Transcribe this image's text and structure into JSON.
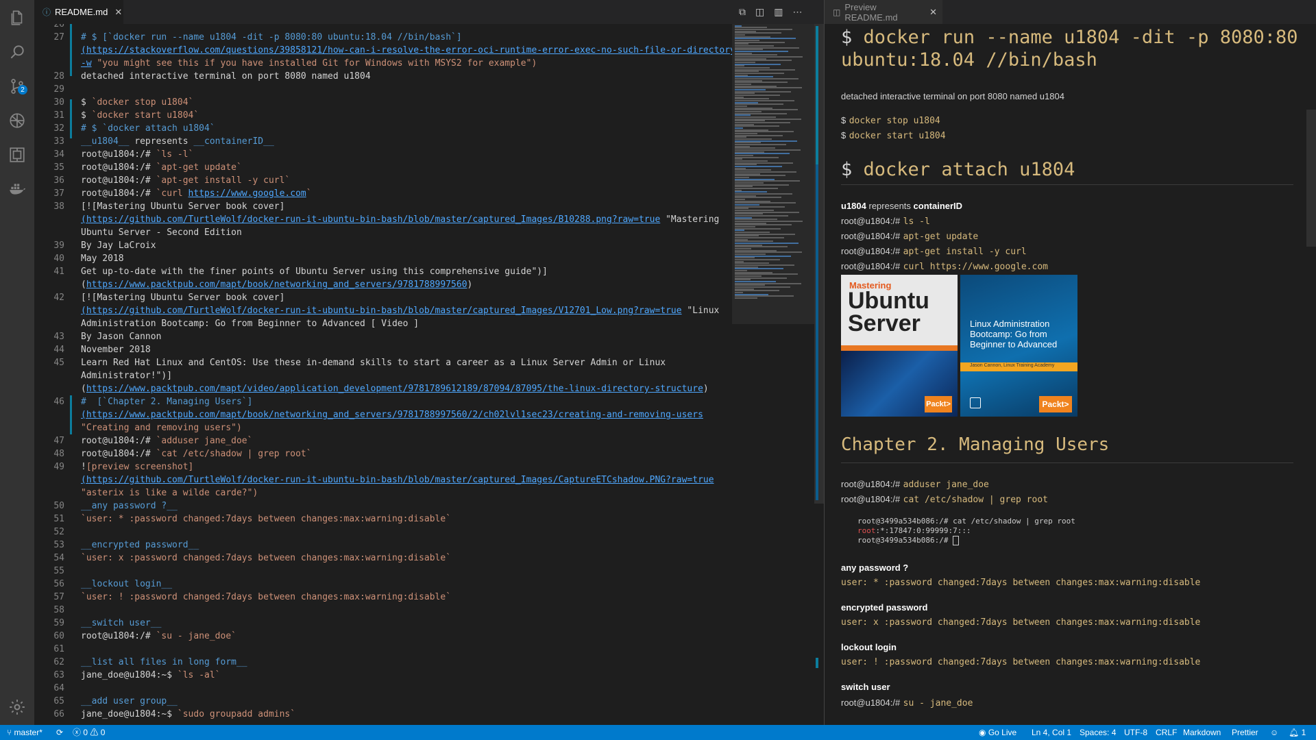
{
  "editor_tab": {
    "title": "README.md"
  },
  "preview_tab": {
    "title": "Preview README.md"
  },
  "editor_lines": [
    {
      "n": "26",
      "parts": [
        [
          "",
          ""
        ]
      ]
    },
    {
      "n": "27",
      "parts": [
        [
          "hash",
          "# $ [`docker run --name u1804 -dit -p 8080:80 ubuntu:18.04 //bin/bash`]"
        ]
      ]
    },
    {
      "n": "",
      "parts": [
        [
          "link",
          "(https://stackoverflow.com/questions/39858121/how-can-i-resolve-the-error-oci-runtime-error-exec-no-such-file-or-directory"
        ]
      ]
    },
    {
      "n": "",
      "parts": [
        [
          "link",
          "-w"
        ],
        [
          "str",
          " \"you might see this if you have installed Git for Windows with MSYS2 for example\")"
        ]
      ]
    },
    {
      "n": "28",
      "parts": [
        [
          "",
          "detached interactive terminal on port 8080 named u1804"
        ]
      ]
    },
    {
      "n": "29",
      "parts": [
        [
          "",
          ""
        ]
      ]
    },
    {
      "n": "30",
      "parts": [
        [
          "",
          "$ "
        ],
        [
          "code",
          "`docker stop u1804`"
        ]
      ]
    },
    {
      "n": "31",
      "parts": [
        [
          "",
          "$ "
        ],
        [
          "code",
          "`docker start u1804`"
        ]
      ]
    },
    {
      "n": "32",
      "parts": [
        [
          "hash",
          "# $ `docker attach u1804`"
        ]
      ]
    },
    {
      "n": "33",
      "parts": [
        [
          "bold",
          "__u1804__"
        ],
        [
          "",
          " represents "
        ],
        [
          "bold",
          "__containerID__"
        ]
      ]
    },
    {
      "n": "34",
      "parts": [
        [
          "",
          "root@u1804:/# "
        ],
        [
          "code",
          "`ls -l`"
        ]
      ]
    },
    {
      "n": "35",
      "parts": [
        [
          "",
          "root@u1804:/# "
        ],
        [
          "code",
          "`apt-get update`"
        ]
      ]
    },
    {
      "n": "36",
      "parts": [
        [
          "",
          "root@u1804:/# "
        ],
        [
          "code",
          "`apt-get install -y curl`"
        ]
      ]
    },
    {
      "n": "37",
      "parts": [
        [
          "",
          "root@u1804:/# "
        ],
        [
          "code",
          "`curl "
        ],
        [
          "link",
          "https://www.google.com"
        ],
        [
          "code",
          "`"
        ]
      ]
    },
    {
      "n": "38",
      "parts": [
        [
          "",
          "[![Mastering Ubuntu Server book cover]"
        ]
      ]
    },
    {
      "n": "",
      "parts": [
        [
          "link",
          "(https://github.com/TurtleWolf/docker-run-it-ubuntu-bin-bash/blob/master/captured_Images/B10288.png?raw=true"
        ],
        [
          "",
          " \"Mastering"
        ]
      ]
    },
    {
      "n": "",
      "parts": [
        [
          "",
          "Ubuntu Server - Second Edition"
        ]
      ]
    },
    {
      "n": "39",
      "parts": [
        [
          "",
          "By Jay LaCroix"
        ]
      ]
    },
    {
      "n": "40",
      "parts": [
        [
          "",
          "May 2018"
        ]
      ]
    },
    {
      "n": "41",
      "parts": [
        [
          "",
          "Get up-to-date with the finer points of Ubuntu Server using this comprehensive guide\")]"
        ]
      ]
    },
    {
      "n": "",
      "parts": [
        [
          "",
          "("
        ],
        [
          "link",
          "https://www.packtpub.com/mapt/book/networking_and_servers/9781788997560"
        ],
        [
          "",
          ")"
        ]
      ]
    },
    {
      "n": "42",
      "parts": [
        [
          "",
          "[![Mastering Ubuntu Server book cover]"
        ]
      ]
    },
    {
      "n": "",
      "parts": [
        [
          "link",
          "(https://github.com/TurtleWolf/docker-run-it-ubuntu-bin-bash/blob/master/captured_Images/V12701_Low.png?raw=true"
        ],
        [
          "",
          " \"Linux"
        ]
      ]
    },
    {
      "n": "",
      "parts": [
        [
          "",
          "Administration Bootcamp: Go from Beginner to Advanced [ Video ]"
        ]
      ]
    },
    {
      "n": "43",
      "parts": [
        [
          "",
          "By Jason Cannon"
        ]
      ]
    },
    {
      "n": "44",
      "parts": [
        [
          "",
          "November 2018"
        ]
      ]
    },
    {
      "n": "45",
      "parts": [
        [
          "",
          "Learn Red Hat Linux and CentOS: Use these in-demand skills to start a career as a Linux Server Admin or Linux"
        ]
      ]
    },
    {
      "n": "",
      "parts": [
        [
          "",
          "Administrator!\")]"
        ]
      ]
    },
    {
      "n": "",
      "parts": [
        [
          "",
          "("
        ],
        [
          "link",
          "https://www.packtpub.com/mapt/video/application_development/9781789612189/87094/87095/the-linux-directory-structure"
        ],
        [
          "",
          ")"
        ]
      ]
    },
    {
      "n": "46",
      "parts": [
        [
          "hash",
          "#  [`Chapter 2. Managing Users`]"
        ]
      ]
    },
    {
      "n": "",
      "parts": [
        [
          "link",
          "(https://www.packtpub.com/mapt/book/networking_and_servers/9781788997560/2/ch02lvl1sec23/creating-and-removing-users"
        ]
      ]
    },
    {
      "n": "",
      "parts": [
        [
          "str",
          "\"Creating and removing users\")"
        ]
      ]
    },
    {
      "n": "47",
      "parts": [
        [
          "",
          "root@u1804:/# "
        ],
        [
          "code",
          "`adduser jane_doe`"
        ]
      ]
    },
    {
      "n": "48",
      "parts": [
        [
          "",
          "root@u1804:/# "
        ],
        [
          "code",
          "`cat /etc/shadow | grep root`"
        ]
      ]
    },
    {
      "n": "49",
      "parts": [
        [
          "",
          "!"
        ],
        [
          "str",
          "[preview screenshot]"
        ]
      ]
    },
    {
      "n": "",
      "parts": [
        [
          "link",
          "(https://github.com/TurtleWolf/docker-run-it-ubuntu-bin-bash/blob/master/captured_Images/CaptureETCshadow.PNG?raw=true"
        ]
      ]
    },
    {
      "n": "",
      "parts": [
        [
          "str",
          "\"asterix is like a wilde carde?\")"
        ]
      ]
    },
    {
      "n": "50",
      "parts": [
        [
          "bold",
          "__any password ?__"
        ]
      ]
    },
    {
      "n": "51",
      "parts": [
        [
          "code",
          "`user: * :password changed:7days between changes:max:warning:disable`"
        ]
      ]
    },
    {
      "n": "52",
      "parts": [
        [
          "",
          ""
        ]
      ]
    },
    {
      "n": "53",
      "parts": [
        [
          "bold",
          "__encrypted password__"
        ]
      ]
    },
    {
      "n": "54",
      "parts": [
        [
          "code",
          "`user: x :password changed:7days between changes:max:warning:disable`"
        ]
      ]
    },
    {
      "n": "55",
      "parts": [
        [
          "",
          ""
        ]
      ]
    },
    {
      "n": "56",
      "parts": [
        [
          "bold",
          "__lockout login__"
        ]
      ]
    },
    {
      "n": "57",
      "parts": [
        [
          "code",
          "`user: ! :password changed:7days between changes:max:warning:disable`"
        ]
      ]
    },
    {
      "n": "58",
      "parts": [
        [
          "",
          ""
        ]
      ]
    },
    {
      "n": "59",
      "parts": [
        [
          "bold",
          "__switch user__"
        ]
      ]
    },
    {
      "n": "60",
      "parts": [
        [
          "",
          "root@u1804:/# "
        ],
        [
          "code",
          "`su - jane_doe`"
        ]
      ]
    },
    {
      "n": "61",
      "parts": [
        [
          "",
          ""
        ]
      ]
    },
    {
      "n": "62",
      "parts": [
        [
          "bold",
          "__list all files in long form__"
        ]
      ]
    },
    {
      "n": "63",
      "parts": [
        [
          "",
          "jane_doe@u1804:~$ "
        ],
        [
          "code",
          "`ls -al`"
        ]
      ]
    },
    {
      "n": "64",
      "parts": [
        [
          "",
          ""
        ]
      ]
    },
    {
      "n": "65",
      "parts": [
        [
          "bold",
          "__add user group__"
        ]
      ]
    },
    {
      "n": "66",
      "parts": [
        [
          "",
          "jane_doe@u1804:~$ "
        ],
        [
          "code",
          "`sudo groupadd admins`"
        ]
      ]
    }
  ],
  "preview": {
    "h1_prefix": "$",
    "h1_cmd_line1": "docker run --name u1804 -dit -p 8080:80",
    "h1_cmd_line2": "ubuntu:18.04 //bin/bash",
    "p1": "detached interactive terminal on port 8080 named u1804",
    "stop_prompt": "$",
    "stop_cmd": "docker stop u1804",
    "start_prompt": "$",
    "start_cmd": "docker start u1804",
    "h2_prefix": "$",
    "h2_cmd": "docker attach u1804",
    "rep_a": "u1804",
    "rep_mid": " represents ",
    "rep_b": "containerID",
    "prompt": "root@u1804:/#",
    "cmd_ls": "ls -l",
    "cmd_update": "apt-get update",
    "cmd_install": "apt-get install -y curl",
    "cmd_curl": "curl https://www.google.com",
    "book1": {
      "kicker": "Mastering",
      "title1": "Ubuntu",
      "title2": "Server",
      "brand": "Packt>"
    },
    "book2": {
      "title": "Linux Administration Bootcamp: Go from Beginner to Advanced",
      "author": "Jason Cannon, Linux Training Academy",
      "brand": "Packt>"
    },
    "chapter": "Chapter 2. Managing Users",
    "cmd_adduser": "adduser jane_doe",
    "cmd_shadow": "cat /etc/shadow | grep root",
    "term1": "root@3499a534b086:/# cat /etc/shadow | grep root",
    "term2a": "root",
    "term2b": ":*:17847:0:99999:7:::",
    "term3": "root@3499a534b086:/# ",
    "any_pw": "any password ?",
    "any_pw_code": "user: * :password changed:7days between changes:max:warning:disable",
    "enc_pw": "encrypted password",
    "enc_pw_code": "user: x :password changed:7days between changes:max:warning:disable",
    "lock": "lockout login",
    "lock_code": "user: ! :password changed:7days between changes:max:warning:disable",
    "switch": "switch user",
    "cmd_su": "su - jane_doe"
  },
  "statusbar": {
    "branch": "master*",
    "errors": "0",
    "warnings": "0",
    "go_live": "Go Live",
    "position": "Ln 4, Col 1",
    "spaces": "Spaces: 4",
    "encoding": "UTF-8",
    "eol": "CRLF",
    "language": "Markdown",
    "formatter": "Prettier",
    "notifications": "1"
  },
  "activity_badge": "2"
}
